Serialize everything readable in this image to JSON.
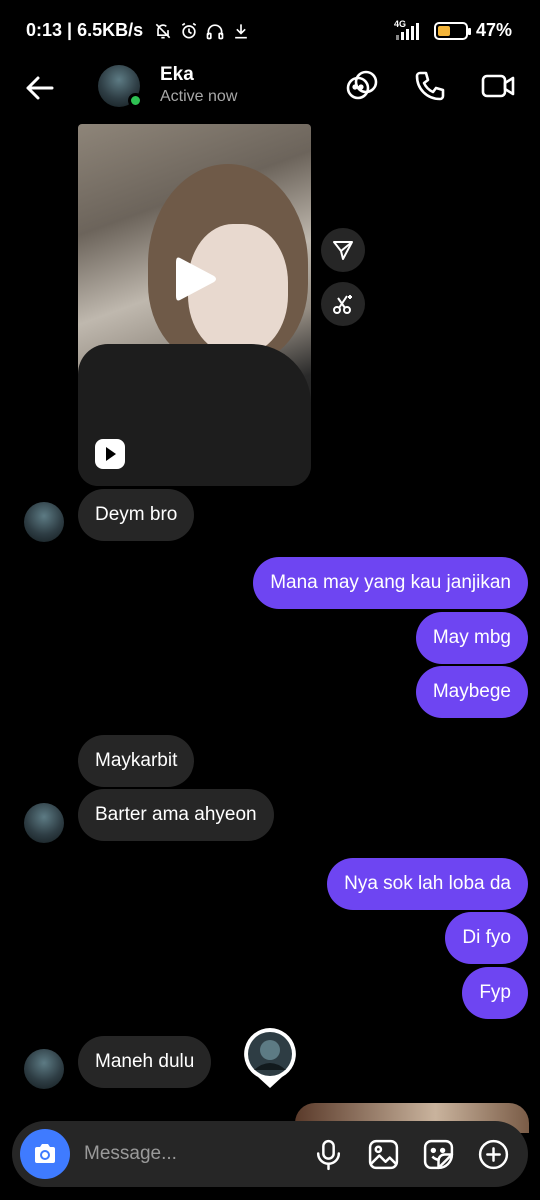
{
  "status_bar": {
    "time_speed": "0:13 | 6.5KB/s",
    "network": "4G",
    "battery_level": 0.47,
    "battery": "47%"
  },
  "header": {
    "contact_name": "Eka",
    "contact_status": "Active now",
    "icons": [
      "back-arrow-icon",
      "stickers-icon",
      "phone-icon",
      "video-camera-icon"
    ]
  },
  "messages": {
    "in_1": "Deym bro",
    "out_1": "Mana may yang kau janjikan",
    "out_2": "May mbg",
    "out_3": "Maybege",
    "in_2": "Maykarbit",
    "in_3": "Barter ama ahyeon",
    "out_4": "Nya sok lah loba da",
    "out_5": "Di fyo",
    "out_6": "Fyp",
    "in_4": "Maneh dulu"
  },
  "composer": {
    "placeholder": "Message...",
    "icons": [
      "camera-icon",
      "microphone-icon",
      "gallery-icon",
      "sticker-icon",
      "plus-icon"
    ]
  },
  "colors": {
    "outgoing_bubble": "#6e45f2",
    "incoming_bubble": "#262626",
    "online": "#2ec153",
    "camera_button": "#3f7bff"
  }
}
